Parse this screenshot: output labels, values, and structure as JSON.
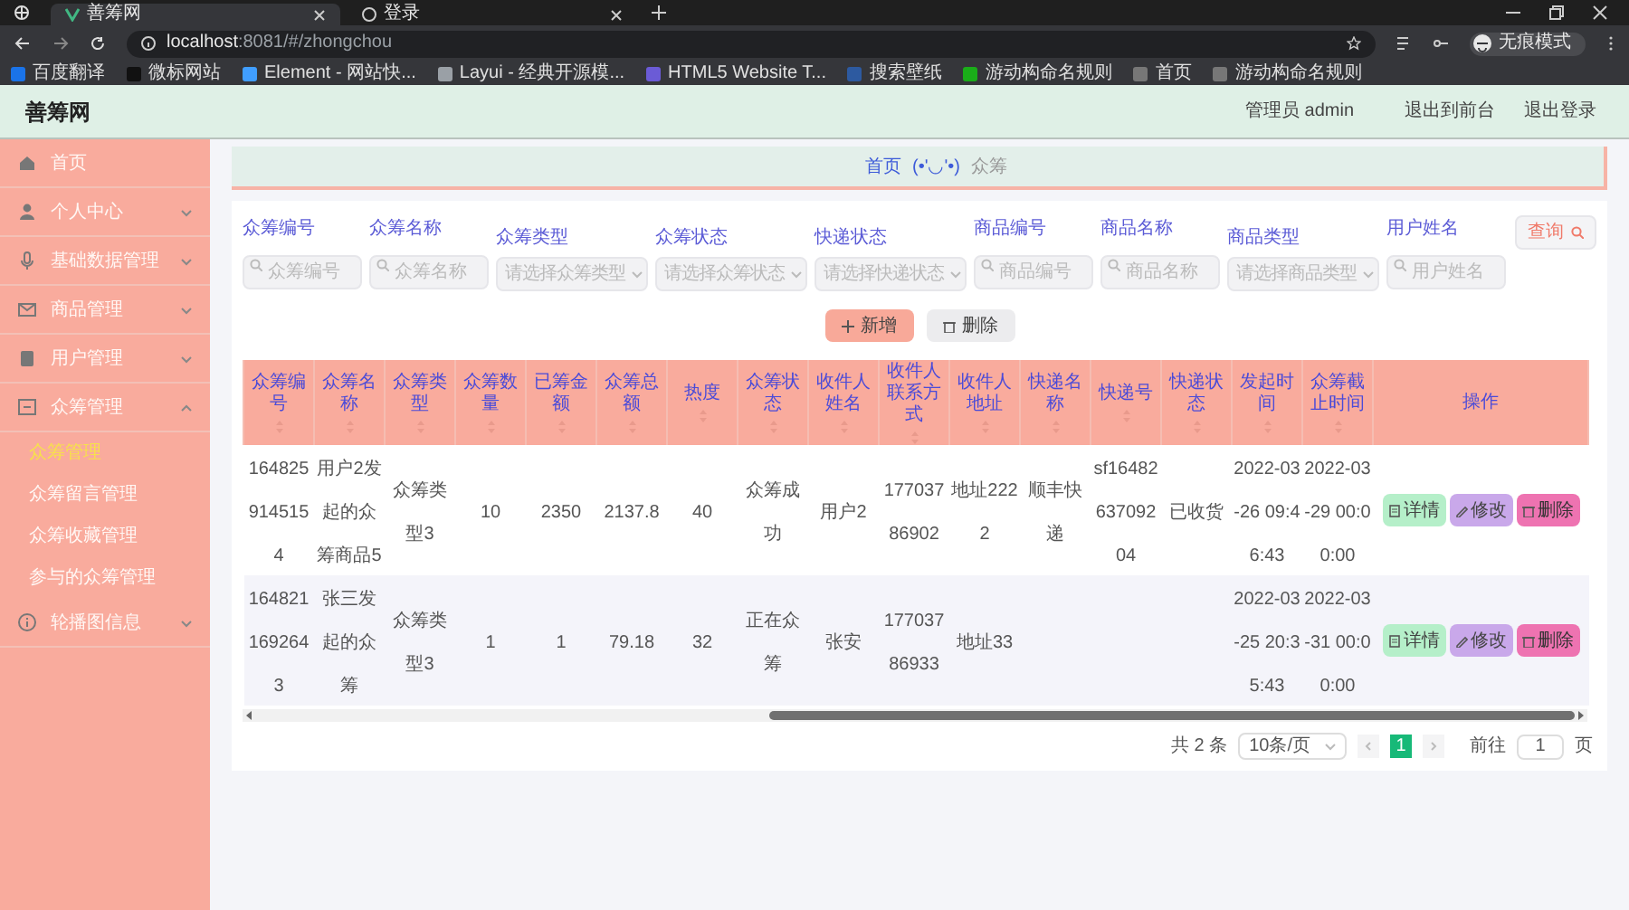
{
  "browser": {
    "tabs": [
      {
        "title": "善筹网",
        "selected": true
      },
      {
        "title": "登录",
        "selected": false
      }
    ],
    "url_host": "localhost",
    "url_path": ":8081/#/zhongchou",
    "profile": "无痕模式",
    "bookmarks": [
      "百度翻译",
      "微标网站",
      "Element - 网站快...",
      "Layui - 经典开源模...",
      "HTML5 Website T...",
      "搜索壁纸",
      "游动构命名规则",
      "首页",
      "游动构命名规则"
    ]
  },
  "header": {
    "title": "善筹网",
    "user": "管理员 admin",
    "links": [
      "退出到前台",
      "退出登录"
    ]
  },
  "sidebar": {
    "items": [
      {
        "label": "首页",
        "kind": "link",
        "selected": false
      },
      {
        "label": "个人中心",
        "kind": "menu",
        "expanded": false
      },
      {
        "label": "基础数据管理",
        "kind": "menu",
        "expanded": false
      },
      {
        "label": "商品管理",
        "kind": "menu",
        "expanded": false
      },
      {
        "label": "用户管理",
        "kind": "menu",
        "expanded": false
      },
      {
        "label": "众筹管理",
        "kind": "menu",
        "expanded": true,
        "children": [
          {
            "label": "众筹管理",
            "selected": true
          },
          {
            "label": "众筹留言管理",
            "selected": false
          },
          {
            "label": "众筹收藏管理",
            "selected": false
          },
          {
            "label": "参与的众筹管理",
            "selected": false
          }
        ]
      },
      {
        "label": "轮播图信息",
        "kind": "menu",
        "expanded": false
      }
    ]
  },
  "breadcrumb": {
    "home": "首页",
    "face": "(•'◡'•)",
    "current": "众筹"
  },
  "filters": [
    {
      "label": "众筹编号",
      "kind": "input",
      "placeholder": "众筹编号"
    },
    {
      "label": "众筹名称",
      "kind": "input",
      "placeholder": "众筹名称"
    },
    {
      "label": "众筹类型",
      "kind": "select",
      "placeholder": "请选择众筹类型"
    },
    {
      "label": "众筹状态",
      "kind": "select",
      "placeholder": "请选择众筹状态"
    },
    {
      "label": "快递状态",
      "kind": "select",
      "placeholder": "请选择快递状态"
    },
    {
      "label": "商品编号",
      "kind": "input",
      "placeholder": "商品编号"
    },
    {
      "label": "商品名称",
      "kind": "input",
      "placeholder": "商品名称"
    },
    {
      "label": "商品类型",
      "kind": "select",
      "placeholder": "请选择商品类型"
    },
    {
      "label": "用户姓名",
      "kind": "input",
      "placeholder": "用户姓名"
    }
  ],
  "search_button": "查询",
  "actions": [
    {
      "label": "新增",
      "kind": "add"
    },
    {
      "label": "删除",
      "kind": "delete"
    }
  ],
  "table": {
    "columns": [
      "众筹编号",
      "众筹名称",
      "众筹类型",
      "众筹数量",
      "已筹金额",
      "众筹总额",
      "热度",
      "众筹状态",
      "收件人姓名",
      "收件人联系方式",
      "收件人地址",
      "快递名称",
      "快递号",
      "快递状态",
      "发起时间",
      "众筹截止时间",
      "操作"
    ],
    "rows": [
      {
        "cells": [
          "1648259145154",
          "用户2发起的众筹商品5",
          "众筹类型3",
          "10",
          "2350",
          "2137.8",
          "40",
          "众筹成功",
          "用户2",
          "17703786902",
          "地址2222",
          "顺丰快递",
          "sf1648263709204",
          "已收货",
          "2022-03-26 09:46:43",
          "2022-03-29 00:00:00"
        ],
        "buttons": [
          {
            "label": "详情",
            "kind": "detail"
          },
          {
            "label": "修改",
            "kind": "edit"
          },
          {
            "label": "删除",
            "kind": "delete"
          }
        ]
      },
      {
        "cells": [
          "1648211692643",
          "张三发起的众筹",
          "众筹类型3",
          "1",
          "1",
          "79.18",
          "32",
          "正在众筹",
          "张安",
          "17703786933",
          "地址33",
          null,
          null,
          null,
          "2022-03-25 20:35:43",
          "2022-03-31 00:00:00"
        ],
        "buttons": [
          {
            "label": "详情",
            "kind": "detail"
          },
          {
            "label": "修改",
            "kind": "edit"
          },
          {
            "label": "删除",
            "kind": "delete"
          }
        ]
      }
    ]
  },
  "pagination": {
    "total": "共 2 条",
    "page_size": "10条/页",
    "pages": [
      {
        "label": "1",
        "selected": true
      }
    ],
    "goto_label": "前往",
    "goto_value": "1",
    "goto_suffix": "页"
  }
}
